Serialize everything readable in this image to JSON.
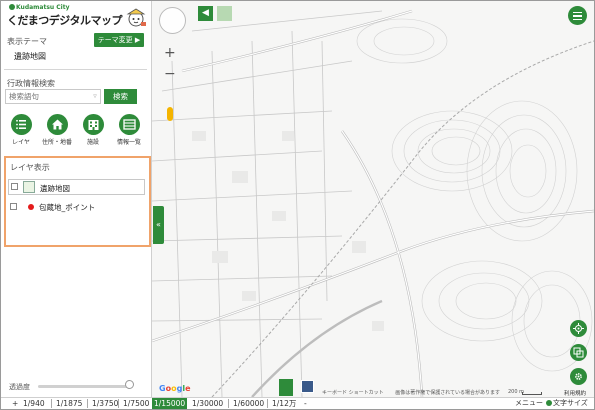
{
  "app": {
    "city_label": "Kudamatsu City",
    "title": "くだまつデジタルマップ"
  },
  "theme": {
    "label": "表示テーマ",
    "change_button": "テーマ変更 ▶",
    "current": "遺跡地図"
  },
  "search": {
    "label": "行政情報検索",
    "placeholder": "検索語句",
    "button": "検索"
  },
  "tools": [
    {
      "label": "レイヤ",
      "icon": "list-icon"
    },
    {
      "label": "住所・地番",
      "icon": "house-icon"
    },
    {
      "label": "施設",
      "icon": "building-icon"
    },
    {
      "label": "情報一覧",
      "icon": "table-icon"
    }
  ],
  "layers": {
    "title": "レイヤ表示",
    "items": [
      {
        "name": "遺跡地図",
        "checked": false
      },
      {
        "name": "包蔵地_ポイント",
        "checked": false,
        "color": "#e41b1b"
      }
    ]
  },
  "opacity": {
    "label": "透過度",
    "value": 1.0
  },
  "map": {
    "collapse_glyph": "«",
    "back_glyph": "◀",
    "zoom_in": "+",
    "zoom_out": "−",
    "google": [
      "G",
      "o",
      "o",
      "g",
      "l",
      "e"
    ],
    "attribution": [
      "キーボード ショートカット",
      "画像は著作権で保護されている場合があります"
    ],
    "scale_label": "200 m",
    "terms": "利用規約",
    "fab_label": "背景切替"
  },
  "scales": {
    "expander": "+",
    "items": [
      "1/940",
      "1/1875",
      "1/3750",
      "1/7500",
      "1/15000",
      "1/30000",
      "1/60000",
      "1/12万"
    ],
    "active": "1/15000",
    "more": "-"
  },
  "footer": {
    "menu": "メニュー",
    "font_size": "文字サイズ"
  },
  "colors": {
    "accent": "#2e8b3a",
    "highlight_border": "#f0a36a"
  }
}
